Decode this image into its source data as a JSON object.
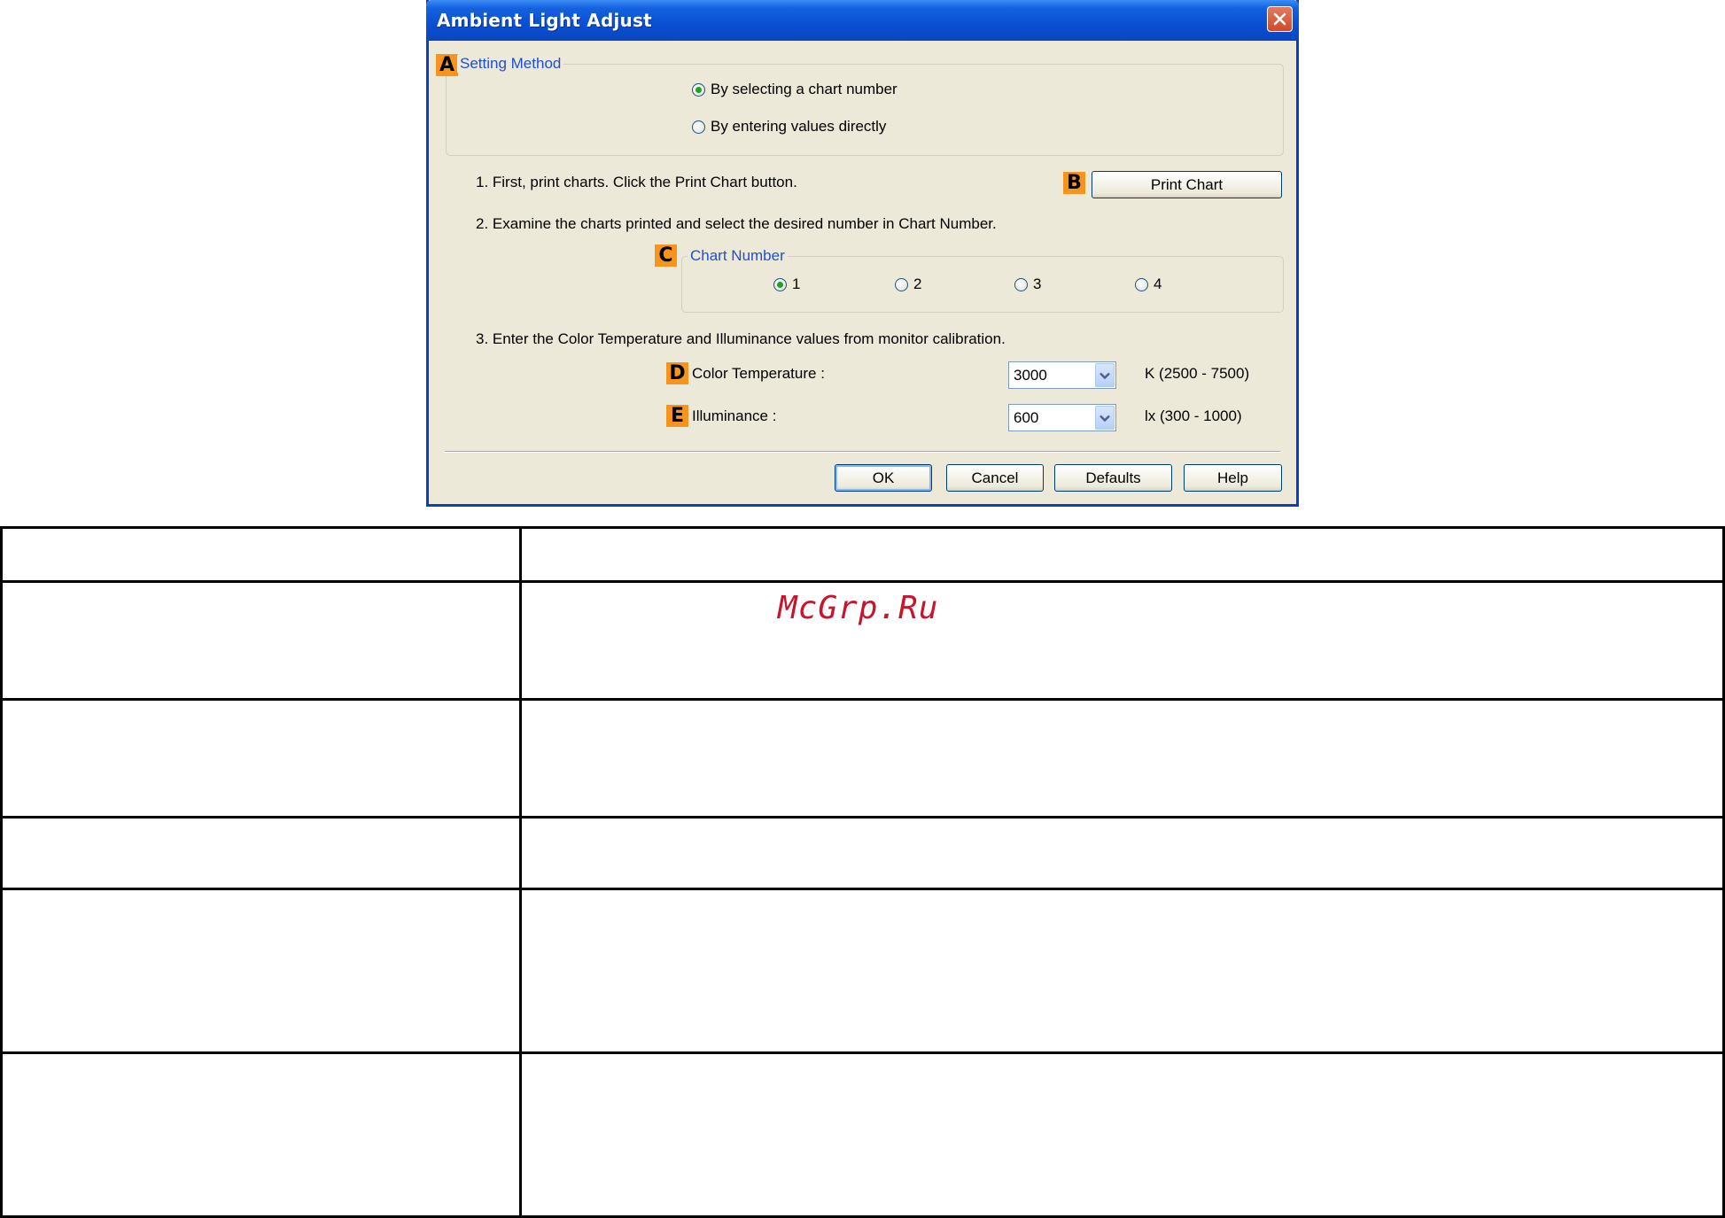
{
  "window": {
    "title": "Ambient Light Adjust"
  },
  "badges": {
    "a": "A",
    "b": "B",
    "c": "C",
    "d": "D",
    "e": "E"
  },
  "setting_method": {
    "label": "Setting Method",
    "options": [
      {
        "label": "By selecting a chart number",
        "selected": true
      },
      {
        "label": "By entering values directly",
        "selected": false
      }
    ]
  },
  "steps": {
    "step1": "1.  First, print charts. Click the Print Chart button.",
    "step2": "2.  Examine the charts printed and select the desired number in Chart Number.",
    "step3": "3.  Enter the Color Temperature and Illuminance values from monitor calibration."
  },
  "print_chart_button": "Print Chart",
  "chart_number": {
    "label": "Chart Number",
    "options": [
      {
        "label": "1",
        "selected": true
      },
      {
        "label": "2",
        "selected": false
      },
      {
        "label": "3",
        "selected": false
      },
      {
        "label": "4",
        "selected": false
      }
    ]
  },
  "color_temperature": {
    "label": "Color Temperature :",
    "value": "3000",
    "range": "K (2500 - 7500)"
  },
  "illuminance": {
    "label": "Illuminance :",
    "value": "600",
    "range": "lx (300 - 1000)"
  },
  "buttons": {
    "ok": "OK",
    "cancel": "Cancel",
    "defaults": "Defaults",
    "help": "Help"
  },
  "watermark": "McGrp.Ru",
  "colors": {
    "title_bar": "#0a4fd2",
    "dialog_bg": "#ece9d8",
    "badge": "#f7941d",
    "radio_selected": "#21a121",
    "watermark": "#c8142c"
  }
}
